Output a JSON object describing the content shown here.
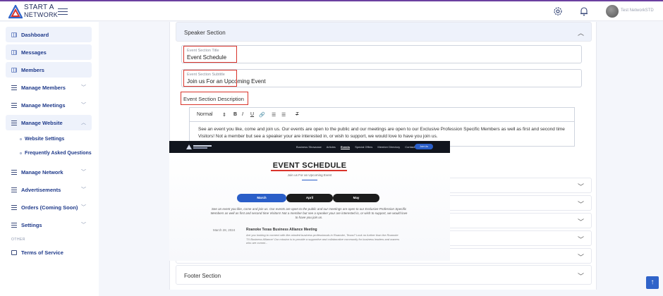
{
  "brand": {
    "line1": "START A",
    "line2": "NETWORK"
  },
  "header": {
    "user_name": "Test NetworkSTD"
  },
  "sidebar": {
    "items": [
      {
        "label": "Dashboard"
      },
      {
        "label": "Messages"
      },
      {
        "label": "Members"
      },
      {
        "label": "Manage Members"
      },
      {
        "label": "Manage Meetings"
      },
      {
        "label": "Manage Website"
      },
      {
        "label": "Manage Network"
      },
      {
        "label": "Advertisements"
      },
      {
        "label": "Orders (Coming Soon)"
      },
      {
        "label": "Settings"
      }
    ],
    "sub_items": [
      {
        "label": "Website Settings"
      },
      {
        "label": "Frequently Asked Questions"
      }
    ],
    "other_label": "OTHER",
    "terms": "Terms of Service"
  },
  "speaker": {
    "section_title": "Speaker Section",
    "title_field_label": "Event Section Title",
    "title_field_value": "Event Schedule",
    "subtitle_field_label": "Event Section Subtitle",
    "subtitle_field_value": "Join us For an Upcoming Event",
    "description_label": "Event Section Description",
    "toolbar": {
      "format": "Normal",
      "bold": "B",
      "italic": "I",
      "underline": "U",
      "link": "🔗",
      "ol": "☰",
      "ul": "☰",
      "clear": "T"
    },
    "description_text": "See an event you like, come and join us. Our events are open to the public and our meetings are open to our Exclusive Profession Specific Members as well as first and second time Visitors! Not a member but see a speaker your are interested in, or wish to support, we would love to have you join us."
  },
  "footer_section": {
    "title": "Footer Section"
  },
  "preview": {
    "nav_links": [
      "Business Showcase",
      "Articles",
      "Events",
      "Special Offers",
      "Member Directory",
      "Contact"
    ],
    "active_link": "Events",
    "join_label": "Join Us",
    "title": "EVENT SCHEDULE",
    "subtitle": "Join us For an Upcoming Event",
    "tabs": [
      {
        "label": "March",
        "color": "#2a5ec8"
      },
      {
        "label": "April",
        "color": "#1c1c1c"
      },
      {
        "label": "May",
        "color": "#1c1c1c"
      }
    ],
    "paragraph": "See an event you like, come and join us. Our events are open to the public and our meetings are open to our Exclusive Profession Specific Members as well as first and second time Visitors! Not a member but see a speaker your are interested in, or wish to support, we would love to have you join us.",
    "event": {
      "date": "March 28, 2024",
      "title": "Roanoke Texas Business Alliance Meeting",
      "description": "Are you looking to connect with like-minded business professionals in Roanoke, Texas? Look no further than the Roanoke TX Business Alliance! Our mission is to provide a supportive and collaborative community for business leaders and owners who are commi..."
    }
  },
  "colors": {
    "accent": "#1f3a8a",
    "highlight_red": "#d9342b",
    "primary_blue": "#2f63c9"
  }
}
